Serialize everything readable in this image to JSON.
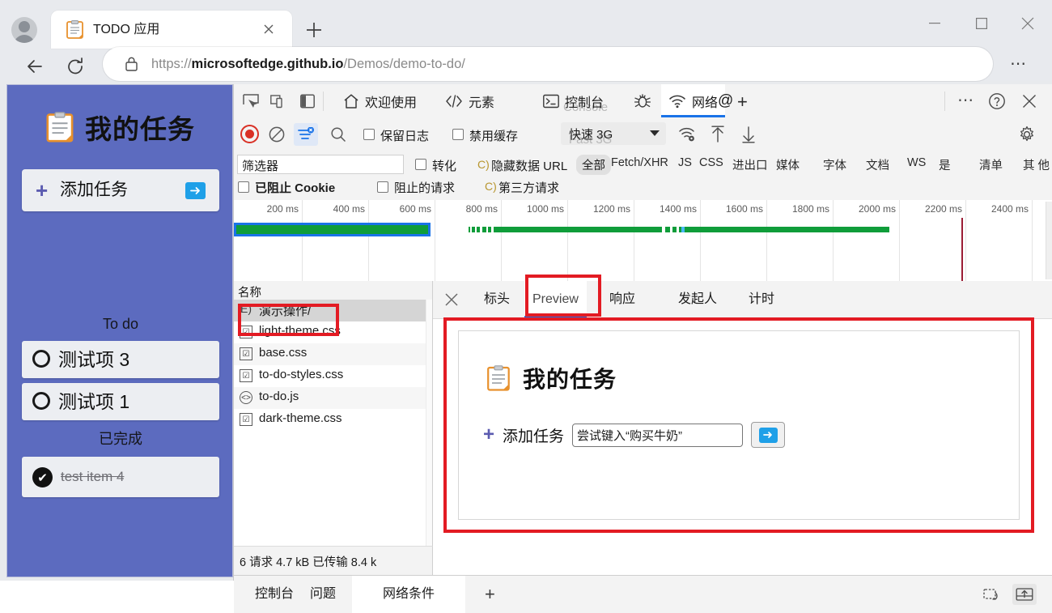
{
  "browser": {
    "tab": {
      "title": "TODO 应用",
      "favicon": "clipboard-icon",
      "close": "×"
    },
    "newtab_label": "+",
    "window": {
      "minimize": "—",
      "maximize": "☐",
      "close": "✕"
    },
    "nav": {
      "back": "←",
      "reload": "⟳",
      "more": "⋯"
    },
    "omnibox": {
      "lock": "lock-icon",
      "url_prefix": "https://",
      "url_domain": "microsoftedge.github.io",
      "url_path": "/Demos/demo-to-do/"
    }
  },
  "todo_app": {
    "title": "我的任务",
    "icon": "clipboard-icon",
    "add_task": {
      "plus": "+",
      "label": "添加任务",
      "submit": "➜"
    },
    "section_todo": "To do",
    "section_done": "已完成",
    "todo_items": [
      {
        "label": "测试项 3"
      },
      {
        "label": "测试项 1"
      }
    ],
    "done_items": [
      {
        "label": "test item 4",
        "check": "✔"
      }
    ]
  },
  "devtools": {
    "tabs": [
      {
        "label": "欢迎使用",
        "icon": "home-icon",
        "shadow": ""
      },
      {
        "label": "元素",
        "icon": "code-icon",
        "shadow": ""
      },
      {
        "label": "控制台",
        "icon": "console-icon",
        "shadow": "Console"
      },
      {
        "label": "",
        "icon": "bug-icon",
        "shadow": ""
      },
      {
        "label": "网络",
        "icon": "wifi-icon",
        "shadow": ""
      }
    ],
    "tab_at": "@",
    "tab_plus": "+",
    "right_buttons": {
      "more": "⋯",
      "help": "?",
      "close": "✕"
    },
    "network_toolbar": {
      "record": "record-icon",
      "clear": "clear-icon",
      "filter": "filter-icon",
      "search": "search-icon",
      "preserve_log": "保留日志",
      "disable_cache": "禁用缓存",
      "throttle_value": "快速 3G",
      "throttle_shadow": "Fast 3G",
      "import_har": "import-har-icon",
      "export_har": "export-har-icon",
      "settings": "gear-icon"
    },
    "filter_row": {
      "filter_placeholder": "筛选器",
      "invert": "转化",
      "hide_data_hint": "C)",
      "hide_data_urls": "隐藏数据 URL",
      "blocked_cookies": "已阻止 Cookie",
      "blocked_requests": "阻止的请求",
      "third_party_hint": "C)",
      "third_party": "第三方请求",
      "types": [
        {
          "label": "全部",
          "selected": true
        },
        {
          "label": "Fetch/XHR",
          "selected": false
        },
        {
          "label": "JS",
          "selected": false
        },
        {
          "label": "CSS",
          "selected": false
        },
        {
          "label": "进出口",
          "selected": false
        },
        {
          "label": "媒体",
          "selected": false
        },
        {
          "label": "字体",
          "selected": false
        },
        {
          "label": "文档",
          "selected": false
        },
        {
          "label": "WS",
          "selected": false
        },
        {
          "label": "是",
          "selected": false
        },
        {
          "label": "清单",
          "selected": false
        },
        {
          "label": "其 他",
          "selected": false
        }
      ]
    },
    "overview": {
      "ticks": [
        "200 ms",
        "400 ms",
        "600 ms",
        "800 ms",
        "1000 ms",
        "1200 ms",
        "1400 ms",
        "1600 ms",
        "1800 ms",
        "2000 ms",
        "2200 ms",
        "2400 ms"
      ]
    },
    "request_list": {
      "header": "名称",
      "rows": [
        {
          "name": "演示操作/",
          "icon": "E)",
          "selected": true
        },
        {
          "name": "light-theme.css",
          "icon": "☑",
          "selected": false
        },
        {
          "name": "base.css",
          "icon": "☑",
          "selected": false
        },
        {
          "name": "to-do-styles.css",
          "icon": "☑",
          "selected": false
        },
        {
          "name": "to-do.js",
          "icon": "<>",
          "selected": false
        },
        {
          "name": "dark-theme.css",
          "icon": "☑",
          "selected": false
        }
      ]
    },
    "status_bar": "6 请求 4.7 kB 已传输 8.4 k",
    "detail_tabs": [
      {
        "label": "标头",
        "active": false
      },
      {
        "label": "Preview",
        "active": true
      },
      {
        "label": "响应",
        "active": false
      },
      {
        "label": "发起人",
        "active": false
      },
      {
        "label": "计时",
        "active": false
      }
    ],
    "detail_close": "✕",
    "preview": {
      "title": "我的任务",
      "icon": "clipboard-icon",
      "plus": "+",
      "add_label": "添加任务",
      "input_value": "尝试键入“购买牛奶”",
      "submit": "➜"
    },
    "drawer": {
      "tabs": [
        {
          "label": "控制台",
          "active": false
        },
        {
          "label": "问题",
          "active": false
        },
        {
          "label": "网络条件",
          "active": true
        }
      ],
      "plus": "+",
      "right_buttons": [
        "screenshot-icon",
        "export-icon"
      ]
    }
  },
  "colors": {
    "accent": "#1a73e8",
    "highlight_red": "#e31b23",
    "app_purple": "#5c6bbf",
    "record_red": "#d93025",
    "timeline_green": "#0f9d3a"
  }
}
